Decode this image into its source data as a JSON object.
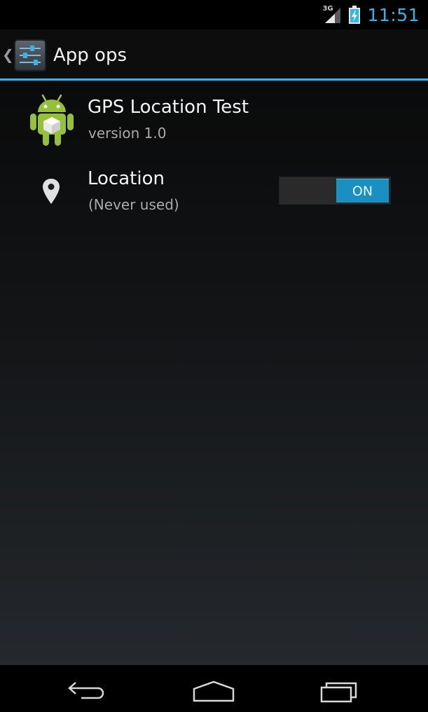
{
  "status_bar": {
    "network": "3G",
    "clock": "11:51",
    "accent": "#33b5e5"
  },
  "action_bar": {
    "title": "App ops",
    "icon": "settings-sliders-icon"
  },
  "app": {
    "name": "GPS Location Test",
    "version": "version 1.0",
    "icon": "android-icon"
  },
  "ops": [
    {
      "label": "Location",
      "subtitle": "(Never used)",
      "icon": "location-pin-icon",
      "toggle_label": "ON",
      "enabled": true
    }
  ],
  "nav_bar": {
    "buttons": [
      "back-icon",
      "home-icon",
      "recent-apps-icon"
    ]
  }
}
